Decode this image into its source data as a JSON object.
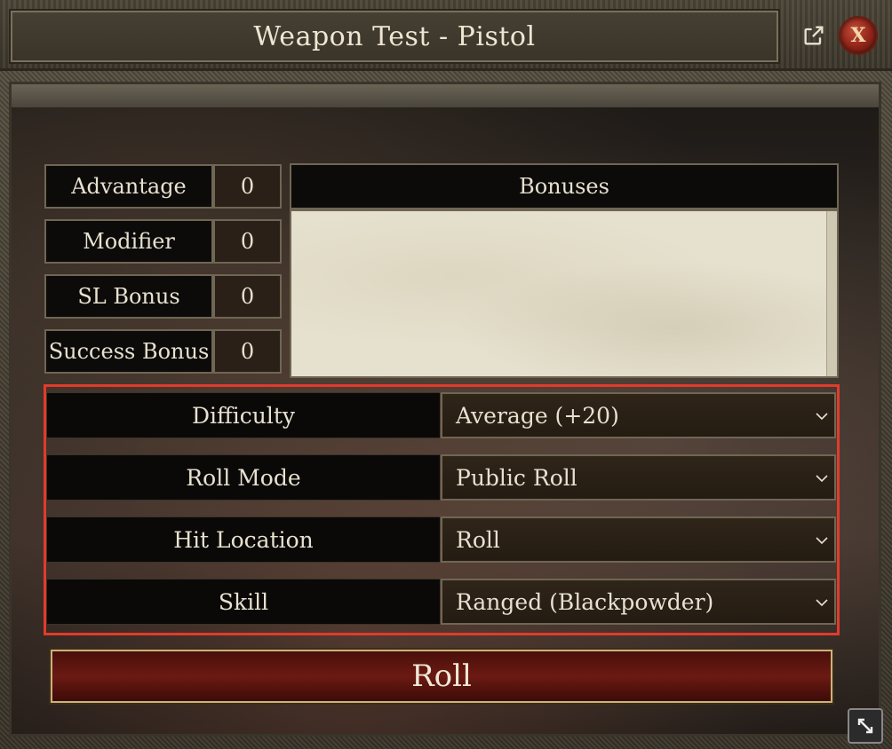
{
  "window": {
    "title": "Weapon Test - Pistol",
    "popout_icon": "external-link-icon",
    "close_label": "X"
  },
  "modifiers": [
    {
      "label": "Advantage",
      "value": "0"
    },
    {
      "label": "Modifier",
      "value": "0"
    },
    {
      "label": "SL Bonus",
      "value": "0"
    },
    {
      "label": "Success Bonus",
      "value": "0"
    }
  ],
  "bonuses": {
    "header": "Bonuses",
    "value": ""
  },
  "selects": [
    {
      "label": "Difficulty",
      "value": "Average (+20)"
    },
    {
      "label": "Roll Mode",
      "value": "Public Roll"
    },
    {
      "label": "Hit Location",
      "value": "Roll"
    },
    {
      "label": "Skill",
      "value": "Ranged (Blackpowder)"
    }
  ],
  "roll_button": "Roll",
  "colors": {
    "highlight": "#e13b2c",
    "roll_button": "#6b1a12",
    "border": "#6f6654"
  }
}
